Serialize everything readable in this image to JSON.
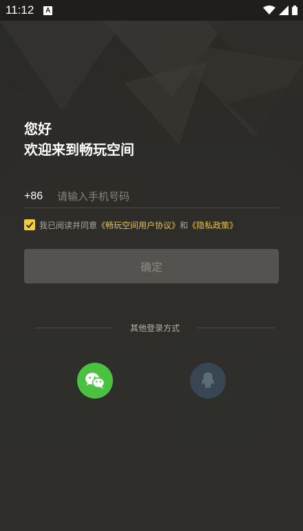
{
  "status_bar": {
    "time": "11:12",
    "notification_icon": "A"
  },
  "greeting": {
    "line1": "您好",
    "line2": "欢迎来到畅玩空间"
  },
  "phone": {
    "country_code": "+86",
    "placeholder": "请输入手机号码",
    "value": ""
  },
  "agreement": {
    "checked": true,
    "prefix": "我已阅读并同意",
    "user_agreement": "《畅玩空间用户协议》",
    "conjunction": "和",
    "privacy_policy": "《隐私政策》"
  },
  "confirm_label": "确定",
  "other_login": {
    "label": "其他登录方式",
    "methods": [
      "wechat-icon",
      "qq-icon"
    ]
  },
  "colors": {
    "background": "#2b2a27",
    "accent": "#f4cd3d",
    "link": "#e6c34a",
    "wechat": "#4ac23f",
    "qq": "#384653",
    "button_disabled": "#54534f"
  }
}
